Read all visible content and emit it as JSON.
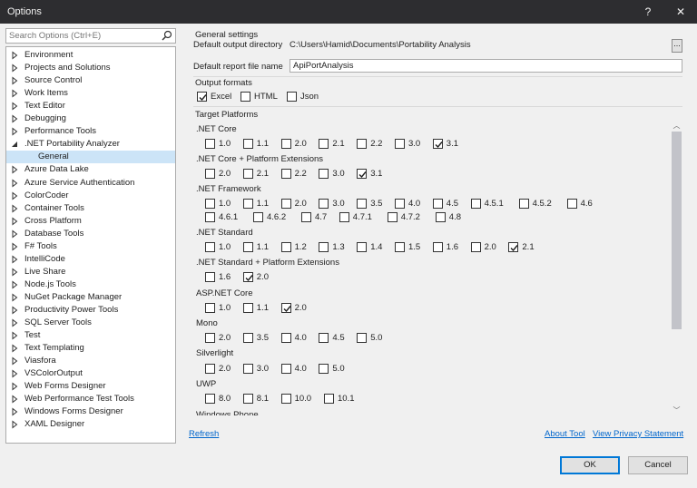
{
  "window": {
    "title": "Options",
    "help": "?",
    "close": "✕"
  },
  "search": {
    "placeholder": "Search Options (Ctrl+E)"
  },
  "tree": {
    "items": [
      {
        "label": "Environment"
      },
      {
        "label": "Projects and Solutions"
      },
      {
        "label": "Source Control"
      },
      {
        "label": "Work Items"
      },
      {
        "label": "Text Editor"
      },
      {
        "label": "Debugging"
      },
      {
        "label": "Performance Tools"
      },
      {
        "label": ".NET Portability Analyzer",
        "expanded": true
      },
      {
        "label": "General",
        "child": true,
        "selected": true
      },
      {
        "label": "Azure Data Lake"
      },
      {
        "label": "Azure Service Authentication"
      },
      {
        "label": "ColorCoder"
      },
      {
        "label": "Container Tools"
      },
      {
        "label": "Cross Platform"
      },
      {
        "label": "Database Tools"
      },
      {
        "label": "F# Tools"
      },
      {
        "label": "IntelliCode"
      },
      {
        "label": "Live Share"
      },
      {
        "label": "Node.js Tools"
      },
      {
        "label": "NuGet Package Manager"
      },
      {
        "label": "Productivity Power Tools"
      },
      {
        "label": "SQL Server Tools"
      },
      {
        "label": "Test"
      },
      {
        "label": "Text Templating"
      },
      {
        "label": "Viasfora"
      },
      {
        "label": "VSColorOutput"
      },
      {
        "label": "Web Forms Designer"
      },
      {
        "label": "Web Performance Test Tools"
      },
      {
        "label": "Windows Forms Designer"
      },
      {
        "label": "XAML Designer"
      }
    ]
  },
  "general": {
    "heading": "General settings",
    "output_dir_label": "Default output directory",
    "output_dir_value": "C:\\Users\\Hamid\\Documents\\Portability Analysis",
    "browse_label": "...",
    "report_name_label": "Default report file name",
    "report_name_value": "ApiPortAnalysis"
  },
  "formats": {
    "heading": "Output formats",
    "items": [
      {
        "label": "Excel",
        "checked": true
      },
      {
        "label": "HTML",
        "checked": false
      },
      {
        "label": "Json",
        "checked": false
      }
    ]
  },
  "platforms": {
    "heading": "Target Platforms",
    "groups": [
      {
        "name": ".NET Core",
        "versions": [
          {
            "label": "1.0",
            "checked": false
          },
          {
            "label": "1.1",
            "checked": false
          },
          {
            "label": "2.0",
            "checked": false
          },
          {
            "label": "2.1",
            "checked": false
          },
          {
            "label": "2.2",
            "checked": false
          },
          {
            "label": "3.0",
            "checked": false
          },
          {
            "label": "3.1",
            "checked": true
          }
        ]
      },
      {
        "name": ".NET Core + Platform Extensions",
        "versions": [
          {
            "label": "2.0",
            "checked": false
          },
          {
            "label": "2.1",
            "checked": false
          },
          {
            "label": "2.2",
            "checked": false
          },
          {
            "label": "3.0",
            "checked": false
          },
          {
            "label": "3.1",
            "checked": true
          }
        ]
      },
      {
        "name": ".NET Framework",
        "versions": [
          {
            "label": "1.0",
            "checked": false
          },
          {
            "label": "1.1",
            "checked": false
          },
          {
            "label": "2.0",
            "checked": false
          },
          {
            "label": "3.0",
            "checked": false
          },
          {
            "label": "3.5",
            "checked": false
          },
          {
            "label": "4.0",
            "checked": false
          },
          {
            "label": "4.5",
            "checked": false
          },
          {
            "label": "4.5.1",
            "checked": false
          },
          {
            "label": "4.5.2",
            "checked": false
          },
          {
            "label": "4.6",
            "checked": false
          },
          {
            "label": "4.6.1",
            "checked": false
          },
          {
            "label": "4.6.2",
            "checked": false
          },
          {
            "label": "4.7",
            "checked": false
          },
          {
            "label": "4.7.1",
            "checked": false
          },
          {
            "label": "4.7.2",
            "checked": false
          },
          {
            "label": "4.8",
            "checked": false
          }
        ]
      },
      {
        "name": ".NET Standard",
        "versions": [
          {
            "label": "1.0",
            "checked": false
          },
          {
            "label": "1.1",
            "checked": false
          },
          {
            "label": "1.2",
            "checked": false
          },
          {
            "label": "1.3",
            "checked": false
          },
          {
            "label": "1.4",
            "checked": false
          },
          {
            "label": "1.5",
            "checked": false
          },
          {
            "label": "1.6",
            "checked": false
          },
          {
            "label": "2.0",
            "checked": false
          },
          {
            "label": "2.1",
            "checked": true
          }
        ]
      },
      {
        "name": ".NET Standard + Platform Extensions",
        "versions": [
          {
            "label": "1.6",
            "checked": false
          },
          {
            "label": "2.0",
            "checked": true
          }
        ]
      },
      {
        "name": "ASP.NET Core",
        "versions": [
          {
            "label": "1.0",
            "checked": false
          },
          {
            "label": "1.1",
            "checked": false
          },
          {
            "label": "2.0",
            "checked": true
          }
        ]
      },
      {
        "name": "Mono",
        "versions": [
          {
            "label": "2.0",
            "checked": false
          },
          {
            "label": "3.5",
            "checked": false
          },
          {
            "label": "4.0",
            "checked": false
          },
          {
            "label": "4.5",
            "checked": false
          },
          {
            "label": "5.0",
            "checked": false
          }
        ]
      },
      {
        "name": "Silverlight",
        "versions": [
          {
            "label": "2.0",
            "checked": false
          },
          {
            "label": "3.0",
            "checked": false
          },
          {
            "label": "4.0",
            "checked": false
          },
          {
            "label": "5.0",
            "checked": false
          }
        ]
      },
      {
        "name": "UWP",
        "versions": [
          {
            "label": "8.0",
            "checked": false
          },
          {
            "label": "8.1",
            "checked": false
          },
          {
            "label": "10.0",
            "checked": false
          },
          {
            "label": "10.1",
            "checked": false
          }
        ]
      },
      {
        "name": "Windows Phone",
        "versions": []
      }
    ]
  },
  "links": {
    "refresh": "Refresh",
    "about": "About Tool",
    "privacy": "View Privacy Statement"
  },
  "buttons": {
    "ok": "OK",
    "cancel": "Cancel"
  },
  "colors": {
    "titlebar": "#2d2d30",
    "selection": "#cce4f7",
    "link": "#0066cc",
    "accent": "#0078d7"
  }
}
